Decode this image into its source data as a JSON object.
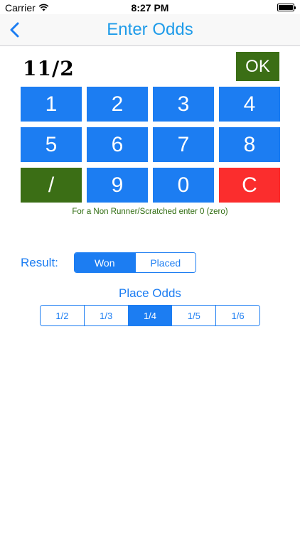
{
  "status_bar": {
    "carrier": "Carrier",
    "time": "8:27 PM"
  },
  "nav": {
    "title": "Enter Odds"
  },
  "display": {
    "odds": "11/2"
  },
  "ok_label": "OK",
  "keypad": [
    {
      "label": "1",
      "kind": "digit"
    },
    {
      "label": "2",
      "kind": "digit"
    },
    {
      "label": "3",
      "kind": "digit"
    },
    {
      "label": "4",
      "kind": "digit"
    },
    {
      "label": "5",
      "kind": "digit"
    },
    {
      "label": "6",
      "kind": "digit"
    },
    {
      "label": "7",
      "kind": "digit"
    },
    {
      "label": "8",
      "kind": "digit"
    },
    {
      "label": "/",
      "kind": "slash"
    },
    {
      "label": "9",
      "kind": "digit"
    },
    {
      "label": "0",
      "kind": "digit"
    },
    {
      "label": "C",
      "kind": "clear"
    }
  ],
  "hint": "For a Non Runner/Scratched enter 0 (zero)",
  "result": {
    "label": "Result:",
    "options": [
      "Won",
      "Placed"
    ],
    "selected": "Won"
  },
  "place_odds": {
    "title": "Place Odds",
    "options": [
      "1/2",
      "1/3",
      "1/4",
      "1/5",
      "1/6"
    ],
    "selected": "1/4"
  },
  "colors": {
    "accent": "#1c7df2",
    "title": "#1e9be9",
    "ok_green": "#3b6e15",
    "clear_red": "#fb2d2d"
  },
  "icons": {
    "wifi": "wifi-icon",
    "battery": "battery-icon",
    "back": "chevron-left-icon"
  }
}
